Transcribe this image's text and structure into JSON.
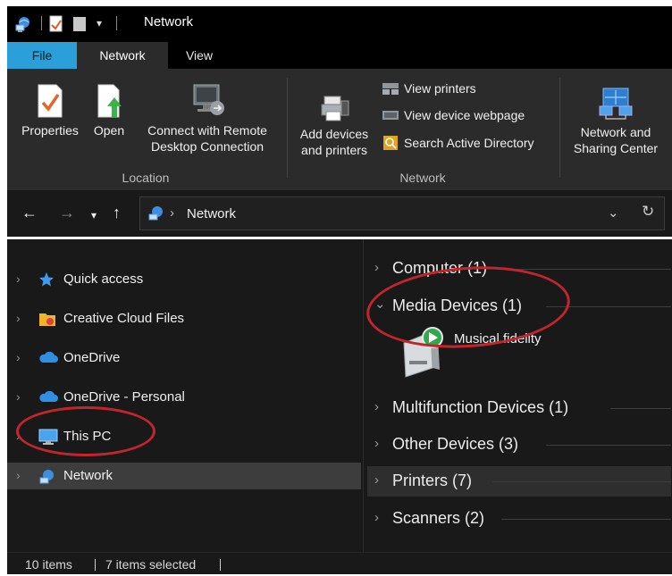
{
  "window": {
    "title": "Network"
  },
  "ribbon": {
    "tabs": [
      {
        "label": "File"
      },
      {
        "label": "Network"
      },
      {
        "label": "View"
      }
    ],
    "location": {
      "label": "Location",
      "properties": "Properties",
      "open": "Open",
      "remote_line1": "Connect with Remote",
      "remote_line2": "Desktop Connection"
    },
    "network": {
      "label": "Network",
      "add_line1": "Add devices",
      "add_line2": "and printers",
      "view_printers": "View printers",
      "view_device_webpage": "View device webpage",
      "search_ad": "Search Active Directory"
    },
    "sharing": {
      "line1": "Network and",
      "line2": "Sharing Center"
    }
  },
  "address": {
    "path": "Network"
  },
  "navpane": {
    "items": [
      {
        "label": "Quick access"
      },
      {
        "label": "Creative Cloud Files"
      },
      {
        "label": "OneDrive"
      },
      {
        "label": "OneDrive - Personal"
      },
      {
        "label": "This PC"
      },
      {
        "label": "Network"
      }
    ]
  },
  "content": {
    "groups": [
      {
        "label": "Computer (1)"
      },
      {
        "label": "Media Devices (1)"
      },
      {
        "label": "Multifunction Devices (1)"
      },
      {
        "label": "Other Devices (3)"
      },
      {
        "label": "Printers (7)"
      },
      {
        "label": "Scanners (2)"
      }
    ],
    "media_device": {
      "label": "Musical fidelity"
    }
  },
  "status": {
    "count": "10 items",
    "selected": "7 items selected"
  },
  "colors": {
    "file_tab": "#2a9fd8",
    "annotation": "#c2262d",
    "background": "#191919"
  }
}
